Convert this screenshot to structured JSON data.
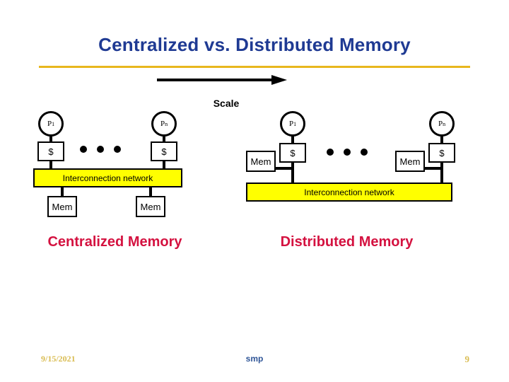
{
  "slide": {
    "title": "Centralized vs. Distributed Memory",
    "accent_rule_color": "#e8b71d",
    "title_color": "#1f3a93"
  },
  "scale": {
    "label": "Scale",
    "arrow_icon": "arrow-right-icon"
  },
  "centralized": {
    "caption": "Centralized Memory",
    "caption_color": "#d41240",
    "network_label": "Interconnection network",
    "network_color": "#ffff00",
    "ellipsis_dot_count": 3,
    "nodes": [
      {
        "processor": "P",
        "processor_sub": "1",
        "cache": "$"
      },
      {
        "processor": "P",
        "processor_sub": "n",
        "cache": "$"
      }
    ],
    "memories": [
      {
        "label": "Mem"
      },
      {
        "label": "Mem"
      }
    ]
  },
  "distributed": {
    "caption": "Distributed Memory",
    "caption_color": "#d41240",
    "network_label": "Interconnection network",
    "network_color": "#ffff00",
    "ellipsis_dot_count": 3,
    "nodes": [
      {
        "processor": "P",
        "processor_sub": "1",
        "cache": "$",
        "memory": "Mem"
      },
      {
        "processor": "P",
        "processor_sub": "n",
        "cache": "$",
        "memory": "Mem"
      }
    ]
  },
  "footer": {
    "date": "9/15/2021",
    "center": "smp",
    "page_number": "9",
    "date_color": "#d9bc52",
    "center_color": "#2f5597"
  }
}
